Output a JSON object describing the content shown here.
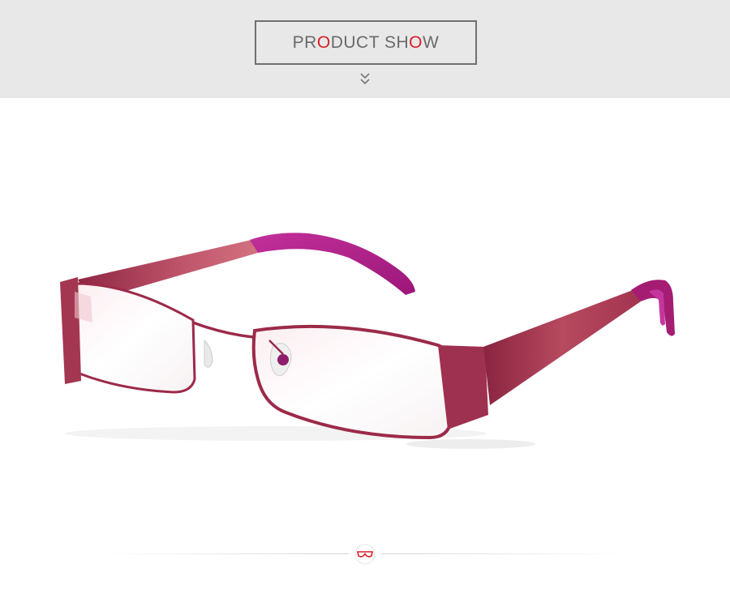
{
  "header": {
    "title_parts": [
      "PR",
      "O",
      "DUCT SH",
      "O",
      "W"
    ],
    "accent_color": "#d61f26",
    "text_color": "#6a6a6a",
    "background_color": "#e8e8e8",
    "scroll_hint_icon": "double-chevron-down-icon"
  },
  "product": {
    "frame_color": "#9c2a49",
    "temple_tip_color": "#b0218d"
  },
  "footer": {
    "logo_icon": "glasses-logo-icon",
    "logo_color": "#d61f26"
  }
}
